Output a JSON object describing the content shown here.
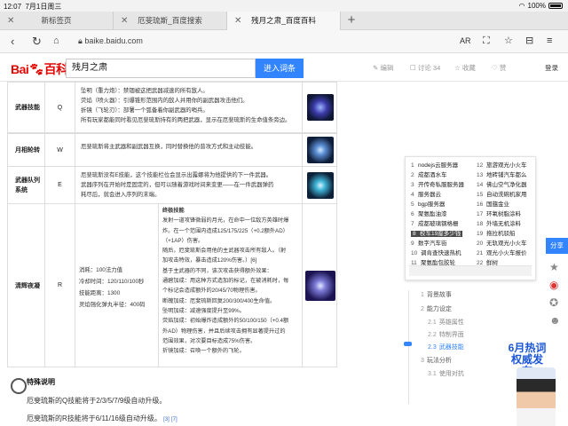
{
  "status": {
    "time": "12:07",
    "date": "7月1日周三",
    "battery": "100%"
  },
  "tabs": [
    {
      "title": "新标签页"
    },
    {
      "title": "厄斐琉斯_百度搜索"
    },
    {
      "title": "残月之肃_百度百科"
    }
  ],
  "url": "baike.baidu.com",
  "reader_label": "AR",
  "header": {
    "logo_text": "Bai",
    "logo_text2": "百科",
    "search_value": "残月之肃",
    "search_button": "进入词条",
    "edit": "编辑",
    "discuss": "讨论 34",
    "collect": "收藏",
    "like": "赞",
    "login": "登录"
  },
  "table": [
    {
      "name": "武器技能",
      "key": "Q",
      "lines": [
        "坠明（重力炮）：禁锢被这把武器减速的所有敌人。",
        "荧焰（喷火器）：引爆锥形范围内的敌人并用你的副武器攻击他们。",
        "折镜（飞轮刃）：部署一个弧备着你副武器的哨兵。",
        "所有玩家都能同时看见厄斐琉斯持有的两把武器，显示在厄斐琉斯的生命值条旁边。"
      ]
    },
    {
      "name": "月相轮转",
      "key": "W",
      "lines": [
        "厄斐琉斯将主武器和副武器互换，同时替换他的普攻方式和主动技能。"
      ]
    },
    {
      "name": "武器队列系统",
      "key": "E",
      "lines": [
        "厄斐琉斯没有E技能，这个技能栏位会显示出露娜将为他提供的下一件武器。",
        "武器序列在开始时是固定的，但可以随着游戏时间来变更——在一件武器弹药",
        "耗尽后，就会进入序列的末端。"
      ]
    },
    {
      "name": "清辉夜凝",
      "key": "R",
      "stats": [
        "消耗：100法力值",
        "冷却时间：120/110/100秒",
        "技能距离：1300",
        "灵焰强化弹丸半径：400码"
      ],
      "lines": [
        "终极技能",
        "发射一道攻锋微弱的月光，在命中一位敌方英雄时爆",
        "炸。在一个范围内造成125/175/225（+0.2额外AD）",
        "（+1AP）伤害。",
        "随后，厄斐琉斯会用他的主武器攻击所有敌人。（射",
        "加攻击特效，暴击造成120%伤害。）[6]",
        "基于主武器的不同，该次攻击获得额外效果：",
        "通碧加成：用这种方式造加的标记，在被消耗时，每",
        "个标记会造成额外的20/45/70物理伤害。",
        "断魄加成：厄斐琉斯回复200/300/400生命值。",
        "坠明加成：减速强度提升至99%。",
        "荧焰加成：初始爆炸造成额外的50/100/150（+0.4额",
        "外AD）物理伤害，并且后续攻击拥有显著提升过的",
        "范围效果，对次要目标造成75%伤害。",
        "折镜加成：召唤一个额外的飞轮。"
      ]
    }
  ],
  "notes": {
    "title": "特殊说明",
    "line1": "厄斐琉斯的Q技能将于2/3/5/7/9级自动升级。",
    "line2": "厄斐琉斯的R技能将于6/11/16级自动升级。",
    "ref1": "[3]",
    "ref2": "[7]"
  },
  "hot": {
    "left": [
      "nodejs云服务器",
      "成都酒水车",
      "开传奇私服服务器",
      "服务器云",
      "bgp服务器",
      "聚氨酯油漆",
      "成都玻璃钢格栅",
      "校车19座多少钱",
      "数字汽车街",
      "调肯查快速热机",
      "聚氨酯包胶轮"
    ],
    "right": [
      "旅游观光小火车",
      "地砖铺汽车都么",
      "佛山空气净化器",
      "自动洗碗机家用",
      "国蕴金业",
      "环氧树脂涂料",
      "外墙无机涂料",
      "拖拉机驳船",
      "无轨观光小火车",
      "观光小火车报价",
      "鲜树"
    ],
    "highlight_index": 7
  },
  "share_label": "分享",
  "toc": [
    {
      "num": "1",
      "label": "背景故事",
      "level": 1
    },
    {
      "num": "2",
      "label": "能力设定",
      "level": 1
    },
    {
      "num": "2.1",
      "label": "英雄属性",
      "level": 2
    },
    {
      "num": "2.2",
      "label": "特制界面",
      "level": 2
    },
    {
      "num": "2.3",
      "label": "武器技能",
      "level": 2,
      "current": true
    },
    {
      "num": "3",
      "label": "玩法分析",
      "level": 1
    },
    {
      "num": "3.1",
      "label": "使用对抗",
      "level": 2
    }
  ],
  "promo": {
    "line1": "6月热词",
    "line2": "权威发布"
  }
}
